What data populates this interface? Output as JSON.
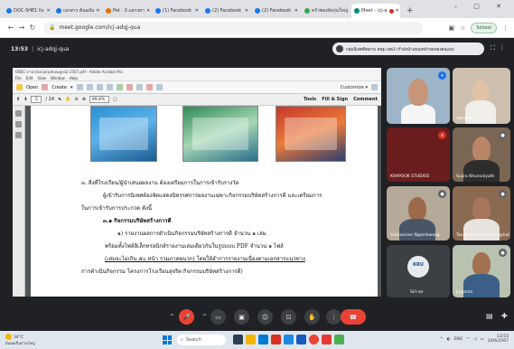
{
  "browser": {
    "tabs": [
      {
        "label": "DOC-SHE1 fo:"
      },
      {
        "label": "เอกสาร ต้นฉบับ"
      },
      {
        "label": "Pet · 3 แสวงหา"
      },
      {
        "label": "(1) Facebook"
      },
      {
        "label": "(2) Facebook"
      },
      {
        "label": "(2) Facebook"
      },
      {
        "label": "ครัวซองท์อรุ่นใหญ่"
      },
      {
        "label": "Meet – icj-a"
      }
    ],
    "new_tab": "+",
    "window_controls": "– ▢ ✕",
    "url": "meet.google.com/icj-adqj-qua",
    "profile_button": "School"
  },
  "meet": {
    "time": "13:53",
    "separator": "|",
    "meeting_code": "icj-adqj-qua",
    "presenting_notice": "กลุ่มนิเทศติดตาม สพฐ.เขต3 (กำลังนำเสนอหน้าจอของตนเอง)",
    "participants": [
      {
        "name": ""
      },
      {
        "name": "บุษบงกช"
      },
      {
        "name": "KRAPOOK STUDIOS"
      },
      {
        "name": "Sujira Khunsaiyuth"
      },
      {
        "name": "Suthasinee Ngamkwang"
      },
      {
        "name": "Tanawaraporn Khemaphat"
      },
      {
        "name": "Siri-on"
      },
      {
        "name": "jiraphan"
      }
    ],
    "avatar_initial": "KRU"
  },
  "acrobat": {
    "title": "OBEC-ภาษาอังกฤษ(ฉบับสมบูรณ์) 2567.pdf - Adobe Acrobat Pro",
    "menu": [
      "File",
      "Edit",
      "View",
      "Window",
      "Help"
    ],
    "toolbar": {
      "open": "Open",
      "create": "Create",
      "customize": "Customize"
    },
    "nav": {
      "page": "5",
      "total": "/ 24",
      "zoom": "99.4%"
    },
    "panels": {
      "tools": "Tools",
      "fill_sign": "Fill & Sign",
      "comment": "Comment"
    }
  },
  "document": {
    "lines": [
      "๓. สิ่งที่โรงเรียน/ผู้นำเสนอผลงาน ต้องเตรียมการในการเข้ารับรางวัล",
      "ผู้เข้ารับการนิเทศต้องจัดแสดงนิทรรศการผลงานเฉพาะกิจกรรมบริษัทสร้างการดี และเตรียมการ",
      "ในการเข้ารับการประกวด ดังนี้",
      "๓.๑ กิจกรรมบริษัทสร้างการดี",
      "๑) รายงานผลการดำเนินกิจกรรมบริษัทสร้างการดี                    จำนวน ๑ เล่ม",
      "พร้อมทั้งไฟล์อิเล็กทรอนิกส์รายงานเล่มเดียวกันในรูปแบบ PDF          จำนวน ๑ ไฟล์",
      "(เล่มจะไม่เกิน ๕๐ หน้า รวมภาคผนวก) โดยให้อำการรายงานเนื่องตามเอกสารแนวทาง",
      "การดำเนินกิจกรรม โครงการโรงเรียนสุจริต กิจกรรมบริษัทสร้างการดี)"
    ]
  },
  "controls": {
    "caret": "^",
    "more": "⋮"
  },
  "taskbar": {
    "temp": "34°C",
    "weather": "มีแดดเป็นส่วนใหญ่",
    "search": "Search",
    "lang": "ENG",
    "time": "13:53",
    "date": "24/6/2567"
  }
}
